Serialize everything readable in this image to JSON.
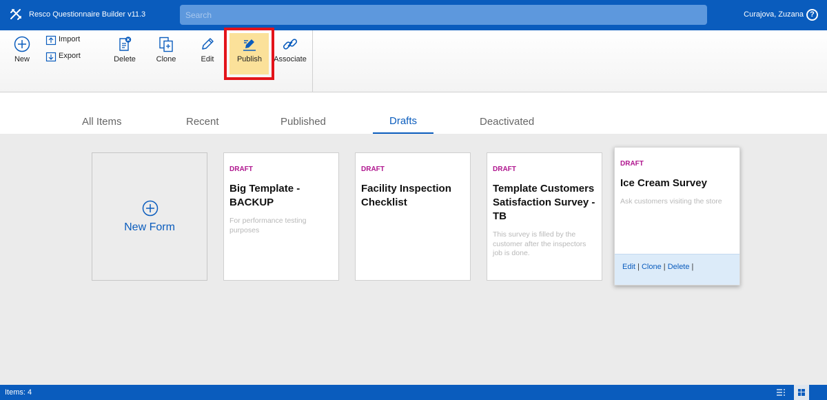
{
  "app": {
    "title": "Resco Questionnaire Builder v11.3",
    "user": "Curajova, Zuzana",
    "help": "?"
  },
  "search": {
    "placeholder": "Search"
  },
  "toolbar": {
    "new_label": "New",
    "import_label": "Import",
    "export_label": "Export",
    "delete_label": "Delete",
    "clone_label": "Clone",
    "edit_label": "Edit",
    "publish_label": "Publish",
    "associate_label": "Associate"
  },
  "tabs": [
    {
      "label": "All Items"
    },
    {
      "label": "Recent"
    },
    {
      "label": "Published"
    },
    {
      "label": "Drafts",
      "active": true
    },
    {
      "label": "Deactivated"
    }
  ],
  "new_form": {
    "label": "New Form"
  },
  "cards": [
    {
      "status": "DRAFT",
      "title": "Big Template - BACKUP",
      "description": "For performance testing purposes"
    },
    {
      "status": "DRAFT",
      "title": "Facility Inspection Checklist",
      "description": ""
    },
    {
      "status": "DRAFT",
      "title": "Template Customers Satisfaction Survey - TB",
      "description": "This survey is filled by the customer after the inspectors job is done."
    },
    {
      "status": "DRAFT",
      "title": "Ice Cream Survey",
      "description": "Ask customers visiting the store",
      "actions": {
        "edit": "Edit",
        "clone": "Clone",
        "delete": "Delete",
        "sep": "|"
      }
    }
  ],
  "status": {
    "items": "Items: 4"
  },
  "colors": {
    "brand": "#0a5cbd",
    "draft": "#b0178f",
    "highlight": "#e3141a",
    "publish_bg": "#fbe19a"
  }
}
